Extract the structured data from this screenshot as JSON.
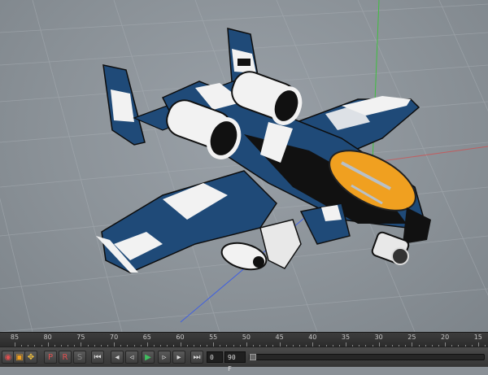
{
  "timeline": {
    "ticks": [
      "85",
      "80",
      "75",
      "70",
      "65",
      "60",
      "55",
      "50",
      "45",
      "40",
      "35",
      "30",
      "25",
      "20",
      "15"
    ]
  },
  "transport": {
    "current_frame": "0",
    "end_frame": "90 F",
    "buttons": [
      {
        "name": "key-record-icon",
        "glyph": "◉"
      },
      {
        "name": "autokey-icon",
        "glyph": "▣"
      },
      {
        "name": "keyframe-selection-icon",
        "glyph": "✥"
      },
      {
        "name": "record-position-icon",
        "glyph": "P"
      },
      {
        "name": "record-rotation-icon",
        "glyph": "R"
      },
      {
        "name": "record-scale-icon",
        "glyph": "S"
      },
      {
        "name": "go-to-start-icon",
        "glyph": "⏮"
      },
      {
        "name": "previous-key-icon",
        "glyph": "◂"
      },
      {
        "name": "previous-frame-icon",
        "glyph": "◃"
      },
      {
        "name": "play-icon",
        "glyph": "▶"
      },
      {
        "name": "next-frame-icon",
        "glyph": "▹"
      },
      {
        "name": "next-key-icon",
        "glyph": "▸"
      },
      {
        "name": "go-to-end-icon",
        "glyph": "⏭"
      }
    ]
  },
  "colors": {
    "viewport_bg": "#8b9298",
    "model_blue": "#1f4a78",
    "model_white": "#f2f2f2",
    "model_black": "#111111",
    "canopy_orange": "#f0a020",
    "axis_green": "#3fbf3f",
    "axis_blue": "#4060e0",
    "axis_red": "#e04040"
  }
}
